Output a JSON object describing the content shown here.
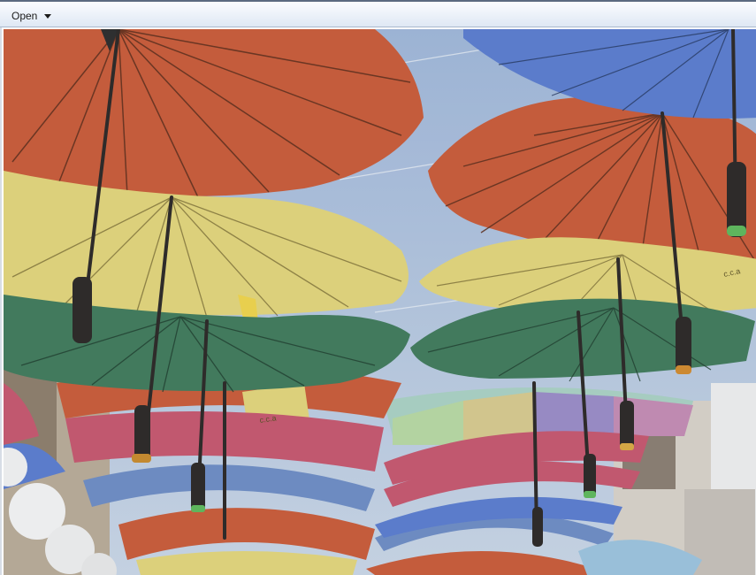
{
  "toolbar": {
    "open_label": "Open"
  },
  "photo": {
    "umbrella_label": "c.c.a"
  },
  "colors": {
    "toolbar_top": "#fafcff",
    "toolbar_bottom": "#dfe8f4",
    "sky": "#a9bdd9",
    "orange": "#c95a37",
    "yellow": "#e3d57a",
    "green": "#3f7a5a",
    "pink": "#c6566d",
    "blue": "#6d8cc4",
    "dark_blue": "#5a7ccf"
  },
  "icons": {
    "dropdown": "chevron-down-icon"
  }
}
